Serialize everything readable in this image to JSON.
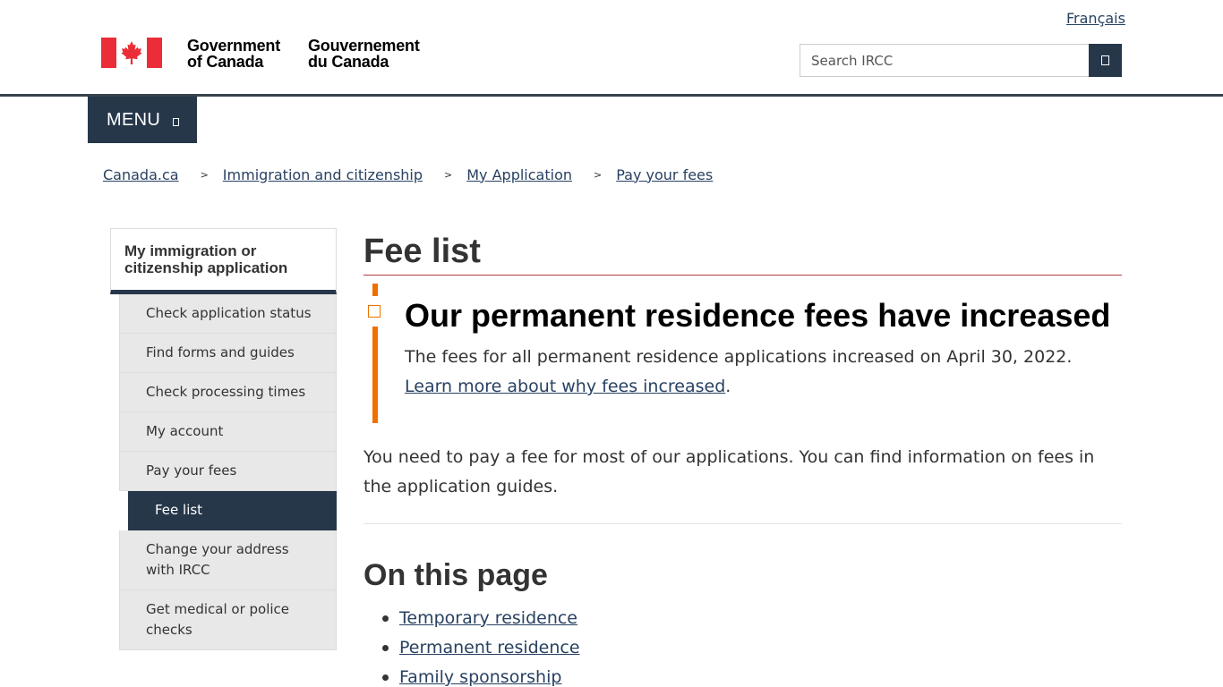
{
  "header": {
    "language_toggle": "Français",
    "brand_en_line1": "Government",
    "brand_en_line2": "of Canada",
    "brand_fr_line1": "Gouvernement",
    "brand_fr_line2": "du Canada",
    "search_placeholder": "Search IRCC",
    "search_button_icon": "search-icon",
    "flag_colors": {
      "red": "#eb2d37",
      "white": "#ffffff"
    }
  },
  "menu": {
    "label": "MENU",
    "icon": "chevron-down-icon"
  },
  "breadcrumb": [
    {
      "label": "Canada.ca"
    },
    {
      "label": "Immigration and citizenship"
    },
    {
      "label": "My Application"
    },
    {
      "label": "Pay your fees"
    }
  ],
  "breadcrumb_separator": ">",
  "sidenav": {
    "heading": "My immigration or citizenship application",
    "items": [
      {
        "label": "Check application status",
        "active": false
      },
      {
        "label": "Find forms and guides",
        "active": false
      },
      {
        "label": "Check processing times",
        "active": false
      },
      {
        "label": "My account",
        "active": false
      },
      {
        "label": "Pay your fees",
        "active": false
      },
      {
        "label": "Fee list",
        "active": true
      },
      {
        "label": "Change your address with IRCC",
        "active": false
      },
      {
        "label": "Get medical or police checks",
        "active": false
      }
    ]
  },
  "main": {
    "title": "Fee list",
    "alert": {
      "icon": "warning-icon",
      "title": "Our permanent residence fees have increased",
      "body_text": "The fees for all permanent residence applications increased on April 30, 2022. ",
      "link_text": "Learn more about why fees increased",
      "body_suffix": "."
    },
    "intro": "You need to pay a fee for most of our applications. You can find information on fees in the application guides.",
    "on_this_page_heading": "On this page",
    "toc": [
      {
        "label": "Temporary residence"
      },
      {
        "label": "Permanent residence"
      },
      {
        "label": "Family sponsorship"
      }
    ]
  },
  "colors": {
    "brand_dark": "#26374a",
    "link": "#284162",
    "alert_accent": "#ee7100",
    "title_rule": "#af3c43"
  }
}
